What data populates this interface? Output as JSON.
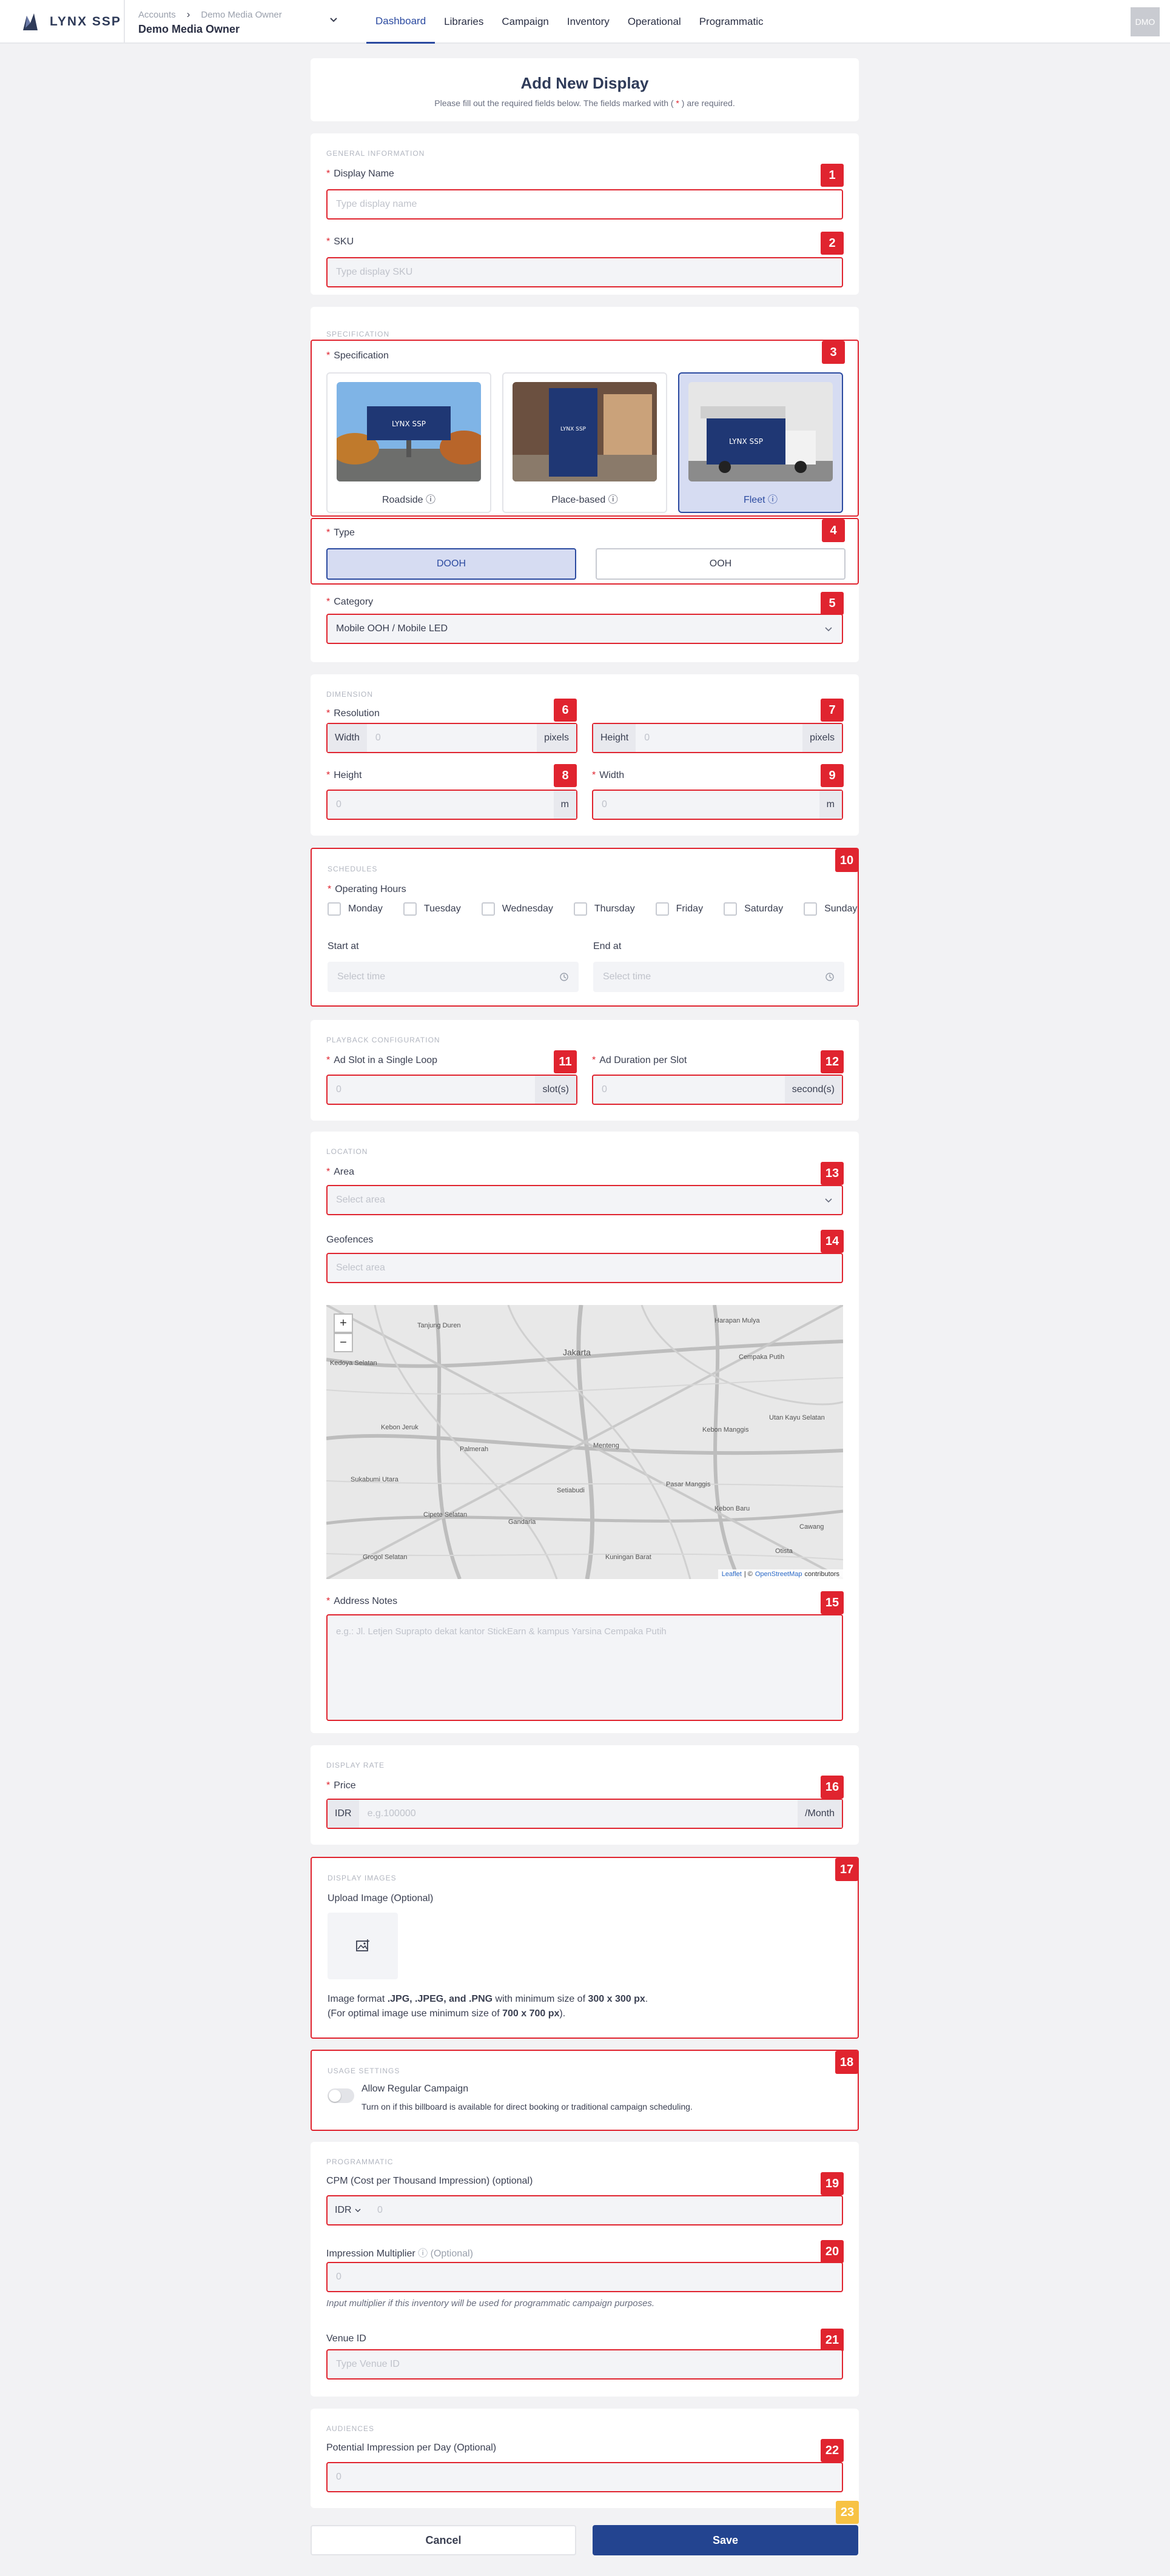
{
  "brand": {
    "name": "LYNX SSP"
  },
  "account": {
    "crumb_root": "Accounts",
    "crumb_current": "Demo Media Owner",
    "name": "Demo Media Owner"
  },
  "nav": [
    "Dashboard",
    "Libraries",
    "Campaign",
    "Inventory",
    "Operational",
    "Programmatic"
  ],
  "user": {
    "initials": "DMO"
  },
  "header": {
    "title": "Add New Display",
    "subtitle_pre": "Please fill out the required fields below. The fields marked with (",
    "subtitle_star": " * ",
    "subtitle_post": ") are required."
  },
  "general": {
    "section": "GENERAL INFORMATION",
    "display_name_label": "Display Name",
    "display_name_placeholder": "Type display name",
    "sku_label": "SKU",
    "sku_placeholder": "Type display SKU"
  },
  "specification": {
    "section": "SPECIFICATION",
    "label": "Specification",
    "options": [
      "Roadside",
      "Place-based",
      "Fleet"
    ],
    "selected": "Fleet",
    "type_label": "Type",
    "types": [
      "DOOH",
      "OOH"
    ],
    "category_label": "Category",
    "category_value": "Mobile OOH / Mobile LED"
  },
  "dimension": {
    "section": "DIMENSION",
    "resolution_label": "Resolution",
    "width_prefix": "Width",
    "height_prefix": "Height",
    "res_unit": "pixels",
    "height_label": "Height",
    "width_label": "Width",
    "zero": "0",
    "meter_unit": "m"
  },
  "schedules": {
    "section": "SCHEDULES",
    "label": "Operating Hours",
    "days": [
      "Monday",
      "Tuesday",
      "Wednesday",
      "Thursday",
      "Friday",
      "Saturday",
      "Sunday"
    ],
    "start_label": "Start at",
    "end_label": "End at",
    "time_placeholder": "Select time"
  },
  "playback": {
    "section": "PLAYBACK CONFIGURATION",
    "slot_label": "Ad Slot in a Single Loop",
    "slot_unit": "slot(s)",
    "duration_label": "Ad Duration per Slot",
    "duration_unit": "second(s)",
    "zero": "0"
  },
  "location": {
    "section": "LOCATION",
    "area_label": "Area",
    "area_placeholder": "Select area",
    "geofences_label": "Geofences",
    "geofences_placeholder": "Select area",
    "zoom_in": "+",
    "zoom_out": "−",
    "attribution_leaflet": "Leaflet",
    "attribution_sep": "| ©",
    "attribution_osm": "OpenStreetMap",
    "attribution_tail": "contributors",
    "map_labels": [
      "Tanjung Duren",
      "Jakarta",
      "Harapan Mulya",
      "Kedoya Selatan",
      "Cempaka Putih",
      "Kebon Jeruk",
      "Palmerah",
      "Menteng",
      "Kebon Manggis",
      "Utan Kayu Selatan",
      "Sukabumi Utara",
      "Setiabudi",
      "Pasar Manggis",
      "Kebon Baru",
      "Cipete Selatan",
      "Gandaria",
      "Kuningan Barat",
      "Otista",
      "Grogol Selatan",
      "Cawang"
    ],
    "notes_label": "Address Notes",
    "notes_placeholder": "e.g.: Jl. Letjen Suprapto dekat kantor StickEarn & kampus Yarsina Cempaka Putih"
  },
  "rate": {
    "section": "DISPLAY RATE",
    "price_label": "Price",
    "currency": "IDR",
    "price_placeholder": "e.g.100000",
    "period": "/Month"
  },
  "images": {
    "section": "DISPLAY IMAGES",
    "label": "Upload Image (Optional)",
    "format_pre": "Image format ",
    "format_types": ".JPG, .JPEG, and .PNG",
    "format_mid": " with minimum size of ",
    "format_min": "300 x 300 px",
    "format_end": ".",
    "optimal_pre": "(For optimal image use minimum size of ",
    "optimal_size": "700 x 700 px",
    "optimal_end": ")."
  },
  "usage": {
    "section": "USAGE SETTINGS",
    "toggle_label": "Allow Regular Campaign",
    "toggle_desc": "Turn on if this billboard is available for direct booking or traditional campaign scheduling.",
    "enabled": false
  },
  "programmatic": {
    "section": "PROGRAMMATIC",
    "cpm_label": "CPM (Cost per Thousand Impression) (optional)",
    "cpm_currency": "IDR",
    "cpm_value": "0",
    "multiplier_label": "Impression Multiplier",
    "multiplier_optional": "(Optional)",
    "multiplier_value": "0",
    "multiplier_hint": "Input multiplier if this inventory will be used for programmatic campaign purposes.",
    "venue_label": "Venue ID",
    "venue_placeholder": "Type Venue ID"
  },
  "audiences": {
    "section": "AUDIENCES",
    "label": "Potential Impression per Day (Optional)",
    "value": "0"
  },
  "actions": {
    "cancel": "Cancel",
    "save": "Save"
  },
  "markers": [
    "1",
    "2",
    "3",
    "4",
    "5",
    "6",
    "7",
    "8",
    "9",
    "10",
    "11",
    "12",
    "13",
    "14",
    "15",
    "16",
    "17",
    "18",
    "19",
    "20",
    "21",
    "22",
    "23"
  ],
  "colors": {
    "accent": "#2b4aa0",
    "required": "#e0242f",
    "marker": "#e0242f",
    "marker_last": "#f7c244",
    "save": "#234490"
  }
}
